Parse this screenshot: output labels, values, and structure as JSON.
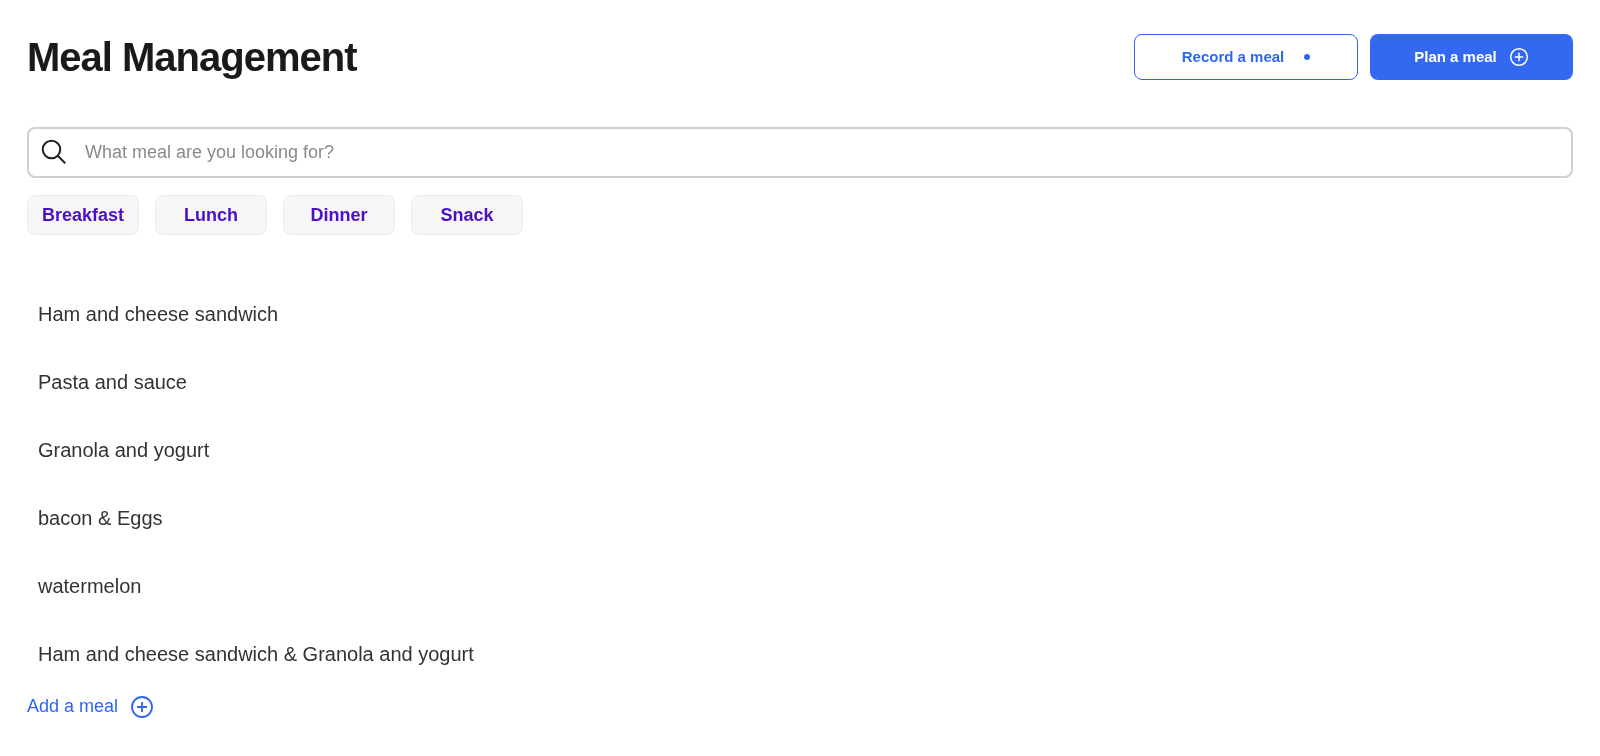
{
  "title": "Meal Management",
  "actions": [
    {
      "kind": "outline",
      "label": "Record a meal"
    },
    {
      "kind": "solid",
      "label": "Plan a meal"
    }
  ],
  "search": {
    "placeholder": "What meal are you looking for?"
  },
  "filters": [
    "Breakfast",
    "Lunch",
    "Dinner",
    "Snack"
  ],
  "meals": [
    "Ham and cheese sandwich",
    "Pasta and sauce",
    "Granola and yogurt",
    "bacon & Eggs",
    "watermelon",
    "Ham and cheese sandwich & Granola and yogurt"
  ],
  "add_link": "Add a meal"
}
